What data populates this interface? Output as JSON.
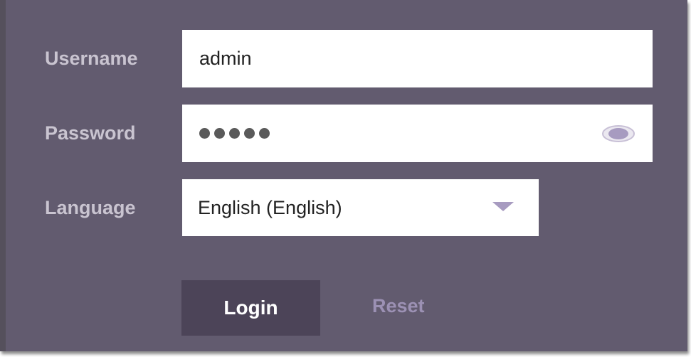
{
  "form": {
    "username_label": "Username",
    "username_value": "admin",
    "password_label": "Password",
    "password_mask": "•••••",
    "password_length": 5,
    "show_password_icon": "eye-icon",
    "language_label": "Language",
    "language_value": "English (English)",
    "language_dropdown_icon": "caret-down-icon",
    "login_label": "Login",
    "reset_label": "Reset"
  },
  "colors": {
    "panel_bg": "#625b6f",
    "label_text": "#c9c4d0",
    "login_button_bg": "#4c4458",
    "reset_text": "#9c91b4",
    "accent_icon": "#a79bc0"
  }
}
